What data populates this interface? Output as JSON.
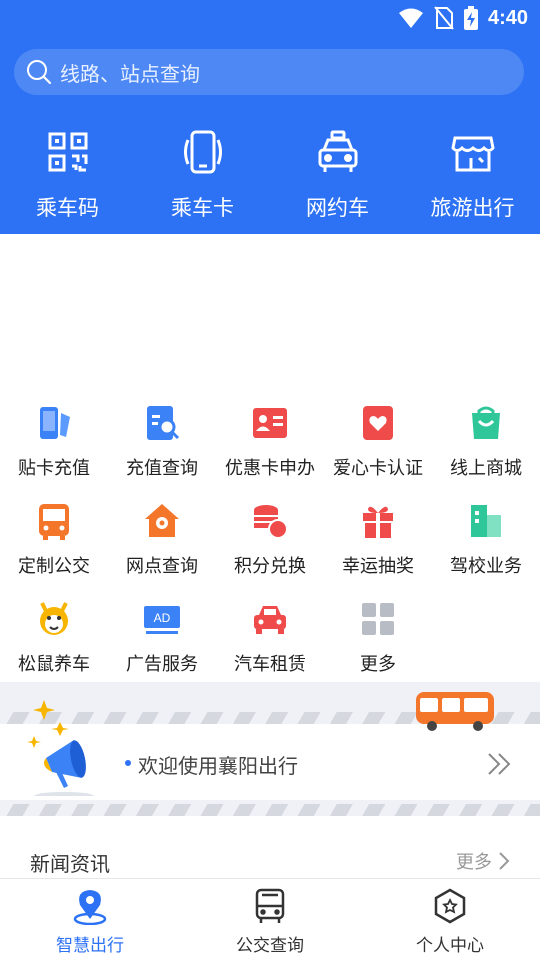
{
  "status_bar": {
    "time": "4:40"
  },
  "search": {
    "placeholder": "线路、站点查询"
  },
  "quick_actions": [
    {
      "label": "乘车码",
      "icon": "qr-code-icon"
    },
    {
      "label": "乘车卡",
      "icon": "phone-card-icon"
    },
    {
      "label": "网约车",
      "icon": "taxi-icon"
    },
    {
      "label": "旅游出行",
      "icon": "store-icon"
    }
  ],
  "services": [
    {
      "label": "贴卡充值",
      "icon": "phone-card-tap-icon",
      "color": "#3b82f6"
    },
    {
      "label": "充值查询",
      "icon": "document-search-icon",
      "color": "#3b82f6"
    },
    {
      "label": "优惠卡申办",
      "icon": "id-card-icon",
      "color": "#f04b4b"
    },
    {
      "label": "爱心卡认证",
      "icon": "heart-card-icon",
      "color": "#f04b4b"
    },
    {
      "label": "线上商城",
      "icon": "shopping-bag-icon",
      "color": "#2fc79a"
    },
    {
      "label": "定制公交",
      "icon": "bus-icon",
      "color": "#f4762b"
    },
    {
      "label": "网点查询",
      "icon": "home-pin-icon",
      "color": "#f4762b"
    },
    {
      "label": "积分兑换",
      "icon": "coins-icon",
      "color": "#f04b4b"
    },
    {
      "label": "幸运抽奖",
      "icon": "gift-icon",
      "color": "#f04b4b"
    },
    {
      "label": "驾校业务",
      "icon": "building-icon",
      "color": "#2fc79a"
    },
    {
      "label": "松鼠养车",
      "icon": "squirrel-icon",
      "color": "#f7b500"
    },
    {
      "label": "广告服务",
      "icon": "ad-icon",
      "color": "#3b82f6"
    },
    {
      "label": "汽车租赁",
      "icon": "car-icon",
      "color": "#f04b4b"
    },
    {
      "label": "更多",
      "icon": "grid-more-icon",
      "color": "#b8bcc4"
    }
  ],
  "notice": {
    "text": "欢迎使用襄阳出行"
  },
  "news": {
    "title": "新闻资讯",
    "more": "更多"
  },
  "tabs": [
    {
      "label": "智慧出行",
      "icon": "location-pin-icon",
      "active": true
    },
    {
      "label": "公交查询",
      "icon": "bus-front-icon",
      "active": false
    },
    {
      "label": "个人中心",
      "icon": "profile-hexagon-icon",
      "active": false
    }
  ],
  "colors": {
    "primary": "#2d72f4",
    "banner_bg": "#eff1f6"
  }
}
